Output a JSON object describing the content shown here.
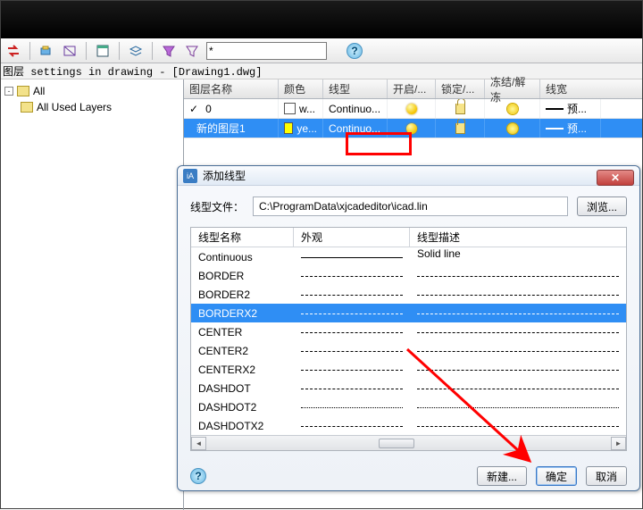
{
  "subtitle": "图层 settings in drawing - [Drawing1.dwg]",
  "tree": {
    "root": "All",
    "child": "All Used Layers"
  },
  "grid": {
    "headers": {
      "name": "图层名称",
      "color": "颜色",
      "ltype": "线型",
      "on": "开启/...",
      "lock": "锁定/...",
      "freeze": "冻结/解冻",
      "lw": "线宽"
    },
    "rows": [
      {
        "name": "0",
        "color": "w...",
        "ltype": "Continuo...",
        "lw": "预...",
        "selected": false,
        "swatch": "white"
      },
      {
        "name": "新的图层1",
        "color": "ye...",
        "ltype": "Continuo...",
        "lw": "预...",
        "selected": true,
        "swatch": "yellow"
      }
    ]
  },
  "dialog": {
    "title": "添加线型",
    "fileLabel": "线型文件：",
    "filePath": "C:\\ProgramData\\xjcadeditor\\icad.lin",
    "browse": "浏览...",
    "headers": {
      "name": "线型名称",
      "look": "外观",
      "desc": "线型描述"
    },
    "rows": [
      {
        "name": "Continuous",
        "pat": "solid",
        "desc": "Solid line"
      },
      {
        "name": "BORDER",
        "pat": "dash",
        "desc": ""
      },
      {
        "name": "BORDER2",
        "pat": "dash",
        "desc": ""
      },
      {
        "name": "BORDERX2",
        "pat": "dash",
        "desc": "",
        "selected": true
      },
      {
        "name": "CENTER",
        "pat": "dash",
        "desc": ""
      },
      {
        "name": "CENTER2",
        "pat": "dash",
        "desc": ""
      },
      {
        "name": "CENTERX2",
        "pat": "dash",
        "desc": ""
      },
      {
        "name": "DASHDOT",
        "pat": "dash",
        "desc": ""
      },
      {
        "name": "DASHDOT2",
        "pat": "dot",
        "desc": ""
      },
      {
        "name": "DASHDOTX2",
        "pat": "dash",
        "desc": ""
      }
    ],
    "new": "新建...",
    "ok": "确定",
    "cancel": "取消"
  }
}
